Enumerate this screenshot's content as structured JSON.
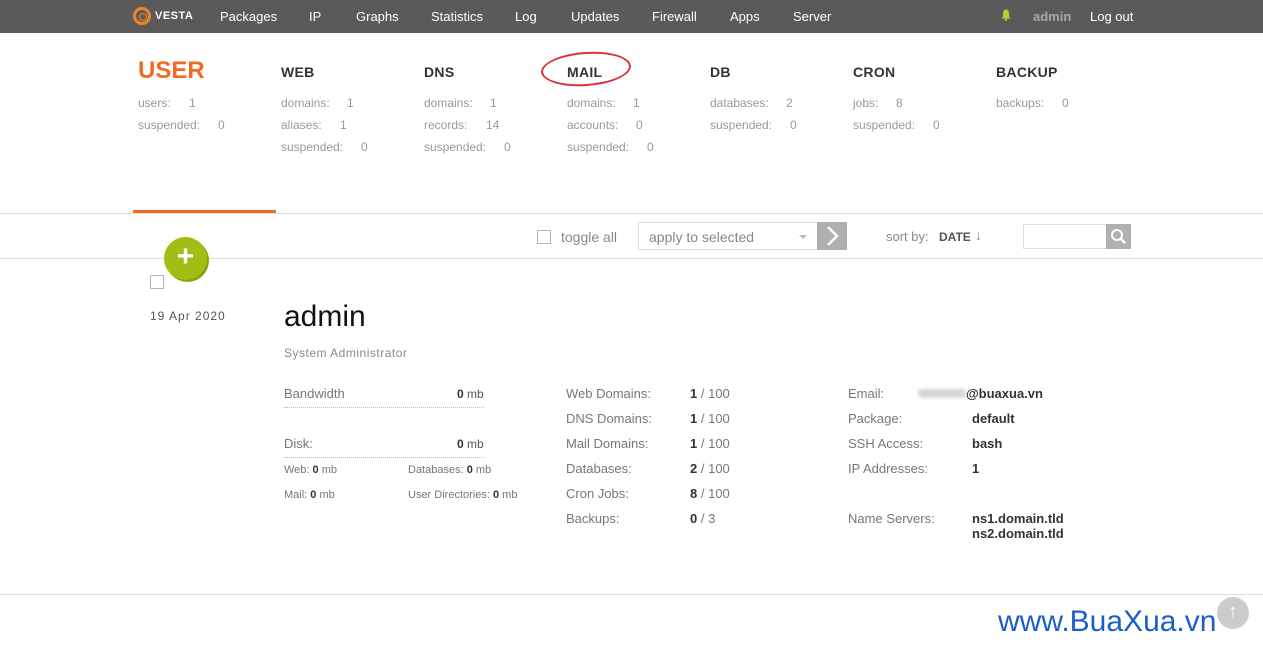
{
  "topbar": {
    "logo_text": "VESTA",
    "nav": [
      "Packages",
      "IP",
      "Graphs",
      "Statistics",
      "Log",
      "Updates",
      "Firewall",
      "Apps",
      "Server"
    ],
    "user": "admin",
    "logout": "Log out"
  },
  "tabs": [
    {
      "title": "USER",
      "stats": [
        {
          "label": "users:",
          "value": "1"
        },
        {
          "label": "suspended:",
          "value": "0"
        }
      ]
    },
    {
      "title": "WEB",
      "stats": [
        {
          "label": "domains:",
          "value": "1"
        },
        {
          "label": "aliases:",
          "value": "1"
        },
        {
          "label": "suspended:",
          "value": "0"
        }
      ]
    },
    {
      "title": "DNS",
      "stats": [
        {
          "label": "domains:",
          "value": "1"
        },
        {
          "label": "records:",
          "value": "14"
        },
        {
          "label": "suspended:",
          "value": "0"
        }
      ]
    },
    {
      "title": "MAIL",
      "stats": [
        {
          "label": "domains:",
          "value": "1"
        },
        {
          "label": "accounts:",
          "value": "0"
        },
        {
          "label": "suspended:",
          "value": "0"
        }
      ]
    },
    {
      "title": "DB",
      "stats": [
        {
          "label": "databases:",
          "value": "2"
        },
        {
          "label": "suspended:",
          "value": "0"
        }
      ]
    },
    {
      "title": "CRON",
      "stats": [
        {
          "label": "jobs:",
          "value": "8"
        },
        {
          "label": "suspended:",
          "value": "0"
        }
      ]
    },
    {
      "title": "BACKUP",
      "stats": [
        {
          "label": "backups:",
          "value": "0"
        }
      ]
    }
  ],
  "toolbar": {
    "toggle_all": "toggle all",
    "apply_placeholder": "apply to selected",
    "sort_label": "sort by:",
    "sort_value": "DATE",
    "sort_arrow": "↓"
  },
  "add_button": "+",
  "user": {
    "date": "19  Apr  2020",
    "name": "admin",
    "role": "System Administrator",
    "bandwidth_label": "Bandwidth",
    "bandwidth_value": "0",
    "bandwidth_unit": "mb",
    "disk_label": "Disk:",
    "disk_value": "0",
    "disk_unit": "mb",
    "disk_web_label": "Web:",
    "disk_web_value": "0",
    "disk_web_unit": "mb",
    "disk_db_label": "Databases:",
    "disk_db_value": "0",
    "disk_db_unit": "mb",
    "disk_mail_label": "Mail:",
    "disk_mail_value": "0",
    "disk_mail_unit": "mb",
    "disk_udir_label": "User Directories:",
    "disk_udir_value": "0",
    "disk_udir_unit": "mb",
    "counts": [
      {
        "label": "Web Domains:",
        "value": "1",
        "limit": "/ 100"
      },
      {
        "label": "DNS Domains:",
        "value": "1",
        "limit": "/ 100"
      },
      {
        "label": "Mail Domains:",
        "value": "1",
        "limit": "/ 100"
      },
      {
        "label": "Databases:",
        "value": "2",
        "limit": "/ 100"
      },
      {
        "label": "Cron Jobs:",
        "value": "8",
        "limit": "/ 100"
      },
      {
        "label": "Backups:",
        "value": "0",
        "limit": "/ 3"
      }
    ],
    "info": {
      "email_label": "Email:",
      "email_value": "@buaxua.vn",
      "package_label": "Package:",
      "package_value": "default",
      "ssh_label": "SSH Access:",
      "ssh_value": "bash",
      "ip_label": "IP Addresses:",
      "ip_value": "1",
      "ns_label": "Name Servers:",
      "ns1": "ns1.domain.tld",
      "ns2": "ns2.domain.tld"
    }
  },
  "scroll_top": "↑",
  "watermark": "www.BuaXua.vn",
  "colors": {
    "accent": "#f36b23",
    "topbar": "#5a5a5a",
    "add_button": "#a3bd15",
    "highlight": "#d9343a"
  }
}
